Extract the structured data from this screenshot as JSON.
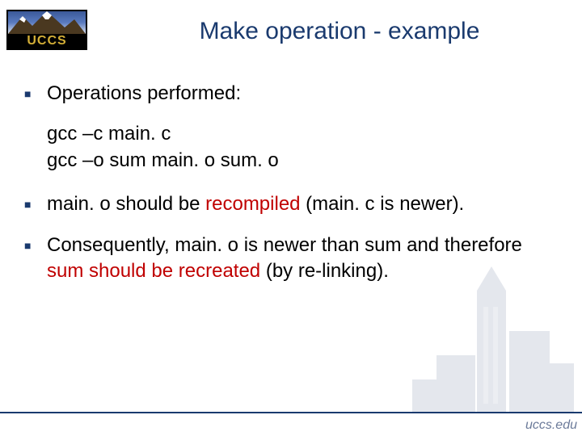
{
  "logo": {
    "text": "UCCS"
  },
  "title": "Make operation - example",
  "bullets": {
    "b1": "Operations performed:",
    "code": {
      "l1": "gcc –c main. c",
      "l2": "gcc –o sum main. o sum. o"
    },
    "b2": {
      "p1": "main. o should be ",
      "red": "recompiled",
      "p2": " (main. c is newer)."
    },
    "b3": {
      "p1": "Consequently, main. o is newer than sum and therefore ",
      "red": "sum should be recreated",
      "p2": " (by re-linking)."
    }
  },
  "footer": {
    "url": "uccs.edu"
  },
  "colors": {
    "brand": "#1a3a6e",
    "accent": "#c00000"
  }
}
